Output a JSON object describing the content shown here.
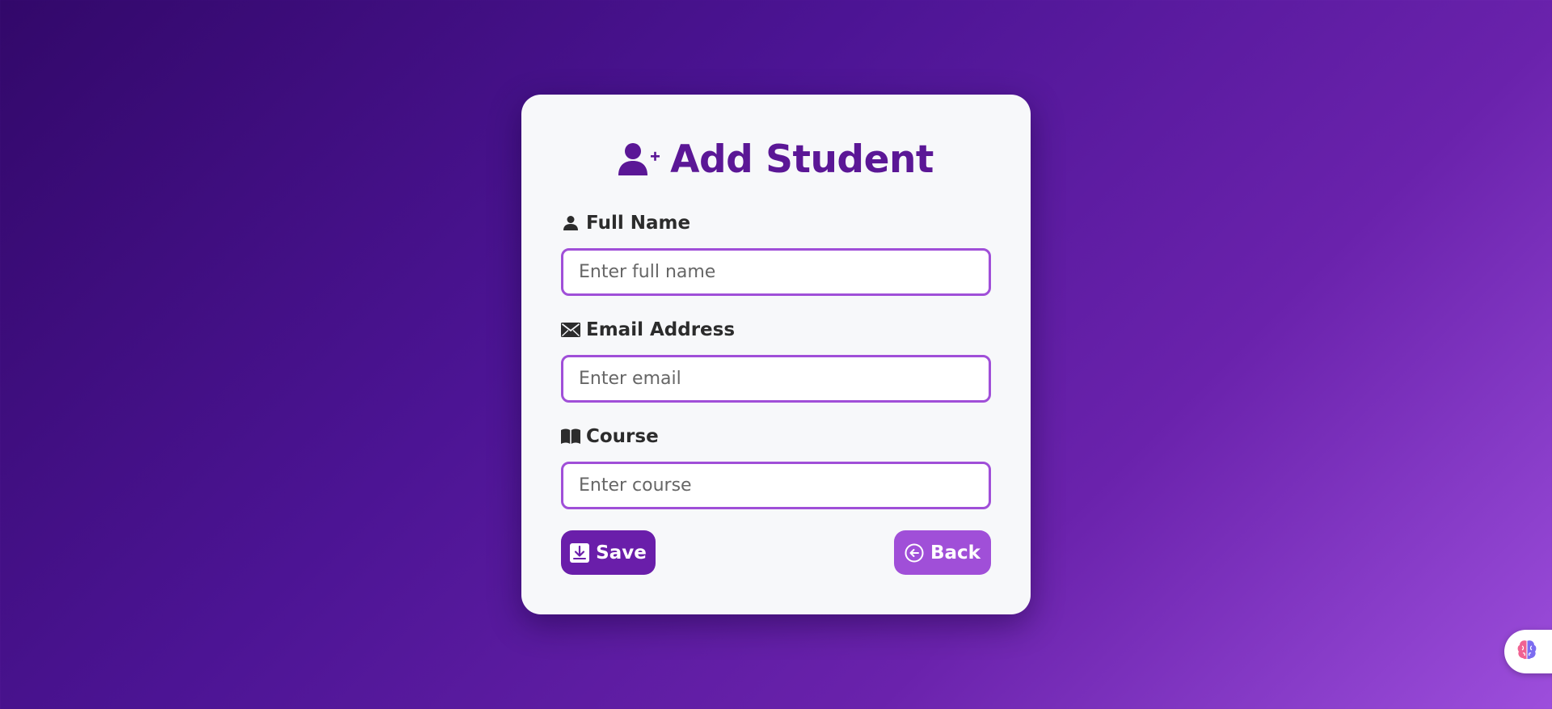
{
  "form": {
    "title": "Add Student",
    "title_icon": "user-plus-icon",
    "fields": [
      {
        "label": "Full Name",
        "icon": "person-icon",
        "value": "",
        "placeholder": "Enter full name"
      },
      {
        "label": "Email Address",
        "icon": "envelope-icon",
        "value": "",
        "placeholder": "Enter email"
      },
      {
        "label": "Course",
        "icon": "book-icon",
        "value": "",
        "placeholder": "Enter course"
      }
    ],
    "save_label": "Save",
    "save_icon": "download-box-icon",
    "back_label": "Back",
    "back_icon": "arrow-left-circle-icon"
  },
  "widget": {
    "icon": "brain-icon"
  },
  "colors": {
    "title": "#5b1796",
    "input_border": "#a04fd8",
    "save_button": "#6a1eaa",
    "back_button": "#a04fd8",
    "background_start": "#32086a",
    "background_end": "#9d4edc"
  }
}
